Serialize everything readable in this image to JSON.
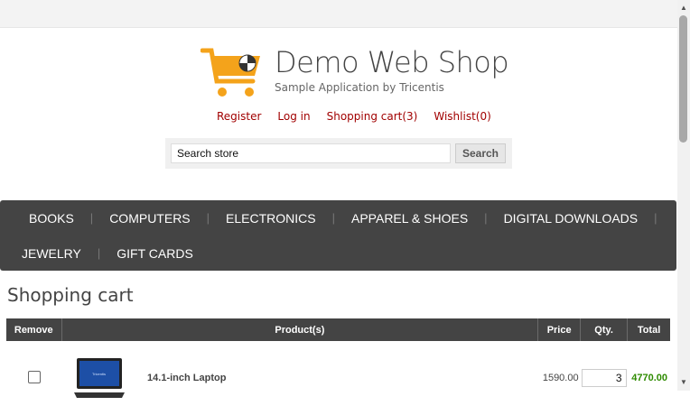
{
  "header": {
    "shop_name": "Demo Web Shop",
    "shop_subtitle": "Sample Application by Tricentis",
    "links": [
      "Register",
      "Log in",
      "Shopping cart(3)",
      "Wishlist(0)"
    ]
  },
  "search": {
    "value": "Search store",
    "button": "Search"
  },
  "menu": {
    "row1": [
      "BOOKS",
      "COMPUTERS",
      "ELECTRONICS",
      "APPAREL & SHOES",
      "DIGITAL DOWNLOADS"
    ],
    "row2": [
      "JEWELRY",
      "GIFT CARDS"
    ]
  },
  "page": {
    "title": "Shopping cart"
  },
  "cart": {
    "columns": [
      "Remove",
      "Product(s)",
      "Price",
      "Qty.",
      "Total"
    ],
    "rows": [
      {
        "product": "14.1-inch Laptop",
        "price": "1590.00",
        "qty": "3",
        "total": "4770.00"
      }
    ]
  },
  "colors": {
    "link": "#a10000",
    "menu_bg": "#444444",
    "total": "#2e8b00",
    "logo": "#f4a31b"
  }
}
